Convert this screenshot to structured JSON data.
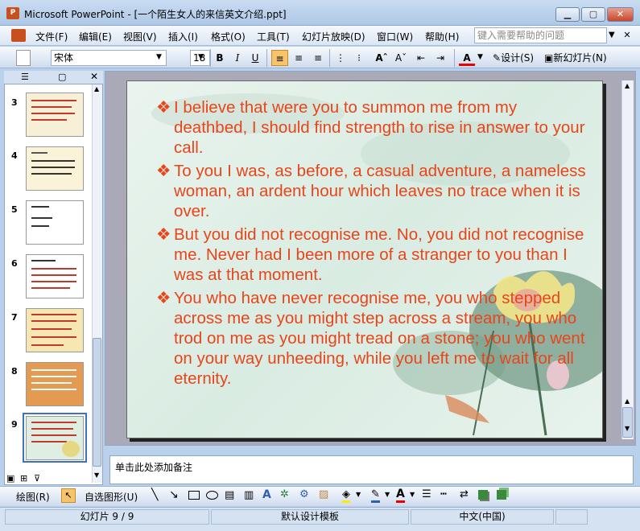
{
  "window": {
    "title": "Microsoft PowerPoint - [一个陌生女人的来信英文介绍.ppt]",
    "app_icon_text": "P",
    "buttons": [
      "minimize",
      "restore",
      "close"
    ]
  },
  "menu": {
    "items": [
      "文件(F)",
      "编辑(E)",
      "视图(V)",
      "插入(I)",
      "格式(O)",
      "工具(T)",
      "幻灯片放映(D)",
      "窗口(W)",
      "帮助(H)"
    ],
    "help_placeholder": "键入需要帮助的问题"
  },
  "toolbar": {
    "font": "宋体",
    "size": "18",
    "bold": "B",
    "italic": "I",
    "underline": "U",
    "design_label": "设计(S)",
    "new_slide_label": "新幻灯片(N)",
    "font_color_label": "A"
  },
  "slides_panel": {
    "numbers": [
      "3",
      "4",
      "5",
      "6",
      "7",
      "8",
      "9"
    ],
    "selected": "9"
  },
  "slide": {
    "bullet_symbol": "❖",
    "paragraphs": [
      "I believe that were you to summon me from my deathbed, I should find strength to rise in answer to your call.",
      "To you I was, as before, a casual adventure, a nameless woman, an ardent hour which leaves no trace when it is over.",
      "But you did not recognise me. No, you did not recognise me. Never had I been more of a stranger to you than I was at that moment.",
      "You who have never recognise me, you who stepped across me as you might step across a stream, you who trod on me as you might tread on a stone; you who went on your way unheeding, while you left me to wait for all eternity."
    ],
    "text_color": "#e8451a"
  },
  "notes": {
    "placeholder": "单击此处添加备注"
  },
  "drawbar": {
    "draw_label": "绘图(R)",
    "autoshapes_label": "自选图形(U)"
  },
  "status": {
    "slide_position": "幻灯片 9 / 9",
    "template": "默认设计模板",
    "language": "中文(中国)"
  }
}
